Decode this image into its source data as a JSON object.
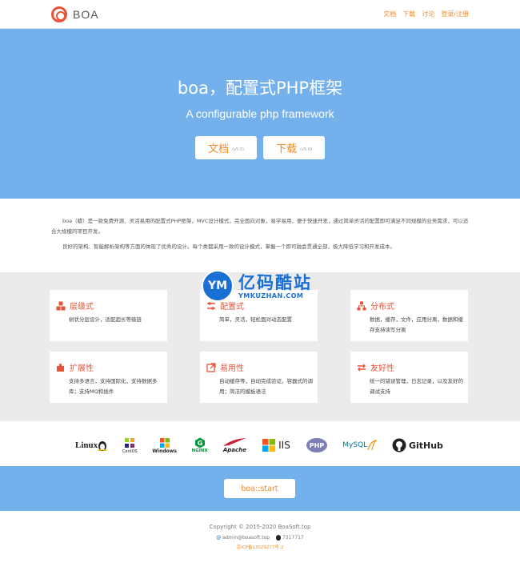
{
  "header": {
    "brand": "BOA",
    "nav": [
      "文档",
      "下载",
      "讨论",
      "登录/注册"
    ]
  },
  "hero": {
    "title": "boa，配置式PHP框架",
    "subtitle": "A configurable php framework",
    "docs_label": "文档",
    "docs_version": "(v5.0)",
    "download_label": "下载",
    "download_version": "(v5.0)"
  },
  "intro": {
    "p1": "boa（蟒）是一款免费开源、灵活易用的配置式PHP框架，MVC设计模式，完全面向对象，易学易用，便于快速开发，通过简单灵活的配置即可满足不同规模的业务需求，可以适合大规模的项目开发。",
    "p2": "良好的架构、智能解析架构等方面的体现了优秀的设计。每个类都采用一致的设计模式，掌握一个即可融会贯通全部，极大降低学习和开发成本。"
  },
  "features": [
    {
      "title": "层级式",
      "desc": "树状分层设计，适配超长等级链"
    },
    {
      "title": "配置式",
      "desc": "简单，灵活，轻松面对动态配置"
    },
    {
      "title": "分布式",
      "desc": "数据，缓存，文件，应用分离，数据和缓存支持读写分离"
    },
    {
      "title": "扩展性",
      "desc": "支持多语言，支持国际化，支持数据多库；支持MQ和插件"
    },
    {
      "title": "易用性",
      "desc": "自动缓存等，自动完成验证，容器式的调用；简洁的模板语法"
    },
    {
      "title": "友好性",
      "desc": "统一的错误管理，日志记录，以及友好的调试支持"
    }
  ],
  "watermark": {
    "badge": "YM",
    "cn": "亿码酷站",
    "en": "YMKUZHAN.COM"
  },
  "tech": [
    "Linux",
    "CentOS",
    "Windows",
    "NGINX",
    "Apache",
    "IIS",
    "PHP",
    "MySQL",
    "GitHub"
  ],
  "start": {
    "label": "boa::start"
  },
  "footer": {
    "copyright": "Copyright © 2015-2020 BoaSoft.top",
    "email": "admin@boasoft.top",
    "qq": "7317717",
    "icp": "京ICP备13029277号-2"
  },
  "colors": {
    "accent": "#f08a24",
    "hero": "#74b1ec",
    "feature_title": "#e8533a"
  }
}
